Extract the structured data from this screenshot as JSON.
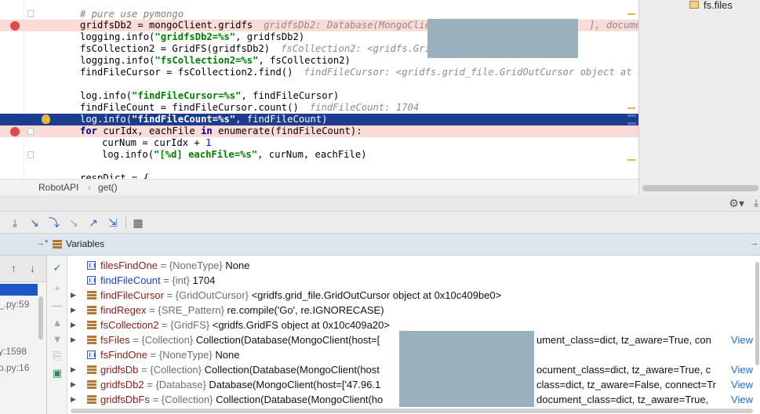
{
  "editor": {
    "comment_line": "# pure use pymongo",
    "lines": {
      "l1_code": "gridfsDb2 = mongoClient.gridfs",
      "l1_hint": "gridfsDb2: Database(MongoClient(",
      "l1_hint_tail": "], document",
      "l2_a": "logging.info(",
      "l2_str": "\"gridfsDb2=%s\"",
      "l2_b": ", gridfsDb2)",
      "l3_code": "fsCollection2 = GridFS(gridfsDb2)",
      "l3_hint": "fsCollection2: <gridfs.GridFS",
      "l4_a": "logging.info(",
      "l4_str": "\"fsCollection2=%s\"",
      "l4_b": ", fsCollection2)",
      "l5_code": "findFileCursor = fsCollection2.find()",
      "l5_hint": "findFileCursor: <gridfs.grid_file.GridOutCursor object at 0x10c",
      "l6_a": "log.info(",
      "l6_str": "\"findFileCursor=%s\"",
      "l6_b": ", findFileCursor)",
      "l7_code": "findFileCount = findFileCursor.count()",
      "l7_hint": "findFileCount: 1704",
      "l8_a": "log.info(",
      "l8_str": "\"findFileCount=%s\"",
      "l8_b": ", findFileCount)",
      "l9_kw1": "for",
      "l9_a": " curIdx, eachFile ",
      "l9_kw2": "in",
      "l9_b": " enumerate(findFileCount):",
      "l10_a": "curNum = curIdx + ",
      "l10_num": "1",
      "l11_a": "log.info(",
      "l11_str": "\"[%d] eachFile=%s\"",
      "l11_b": ", curNum, eachFile)",
      "l12_code": "respDict = {"
    }
  },
  "breadcrumb": {
    "item1": "RobotAPI",
    "sep": "›",
    "item2": "get()"
  },
  "project_panel": {
    "folder_label": "fs.files"
  },
  "variables_panel": {
    "title": "Variables",
    "view_label": "View",
    "rows": [
      {
        "name": "filesFindOne",
        "type": " = {NoneType} ",
        "value": "None",
        "expandable": false,
        "primitive": true
      },
      {
        "name": "findFileCount",
        "type": " = {int} ",
        "value": "1704",
        "expandable": false,
        "primitive": true,
        "changed": true
      },
      {
        "name": "findFileCursor",
        "type": " = {GridOutCursor} ",
        "value": "<gridfs.grid_file.GridOutCursor object at 0x10c409be0>",
        "expandable": true
      },
      {
        "name": "findRegex",
        "type": " = {SRE_Pattern} ",
        "value": "re.compile('Go', re.IGNORECASE)",
        "expandable": true
      },
      {
        "name": "fsCollection2",
        "type": " = {GridFS} ",
        "value": "<gridfs.GridFS object at 0x10c409a20>",
        "expandable": true
      },
      {
        "name": "fsFiles",
        "type": " = {Collection} ",
        "value": "Collection(Database(MongoClient(host=[",
        "value_tail": "ument_class=dict, tz_aware=True, con",
        "expandable": true,
        "view": true
      },
      {
        "name": "fsFindOne",
        "type": " = {NoneType} ",
        "value": "None",
        "expandable": false,
        "primitive": true
      },
      {
        "name": "gridfsDb",
        "type": " = {Collection} ",
        "value": "Collection(Database(MongoClient(host",
        "value_tail": "ocument_class=dict, tz_aware=True, c",
        "expandable": true,
        "view": true
      },
      {
        "name": "gridfsDb2",
        "type": " = {Database} ",
        "value": "Database(MongoClient(host=['47.96.1",
        "value_tail": "class=dict, tz_aware=False, connect=Tr",
        "expandable": true,
        "view": true
      },
      {
        "name": "gridfsDbFs",
        "type": " = {Collection} ",
        "value": "Collection(Database(MongoClient(ho",
        "value_tail": "document_class=dict, tz_aware=True,",
        "expandable": true,
        "view": true
      }
    ]
  },
  "frames_panel": {
    "frames": [
      "_.py:59",
      "y:1598",
      "p.py:16"
    ]
  }
}
